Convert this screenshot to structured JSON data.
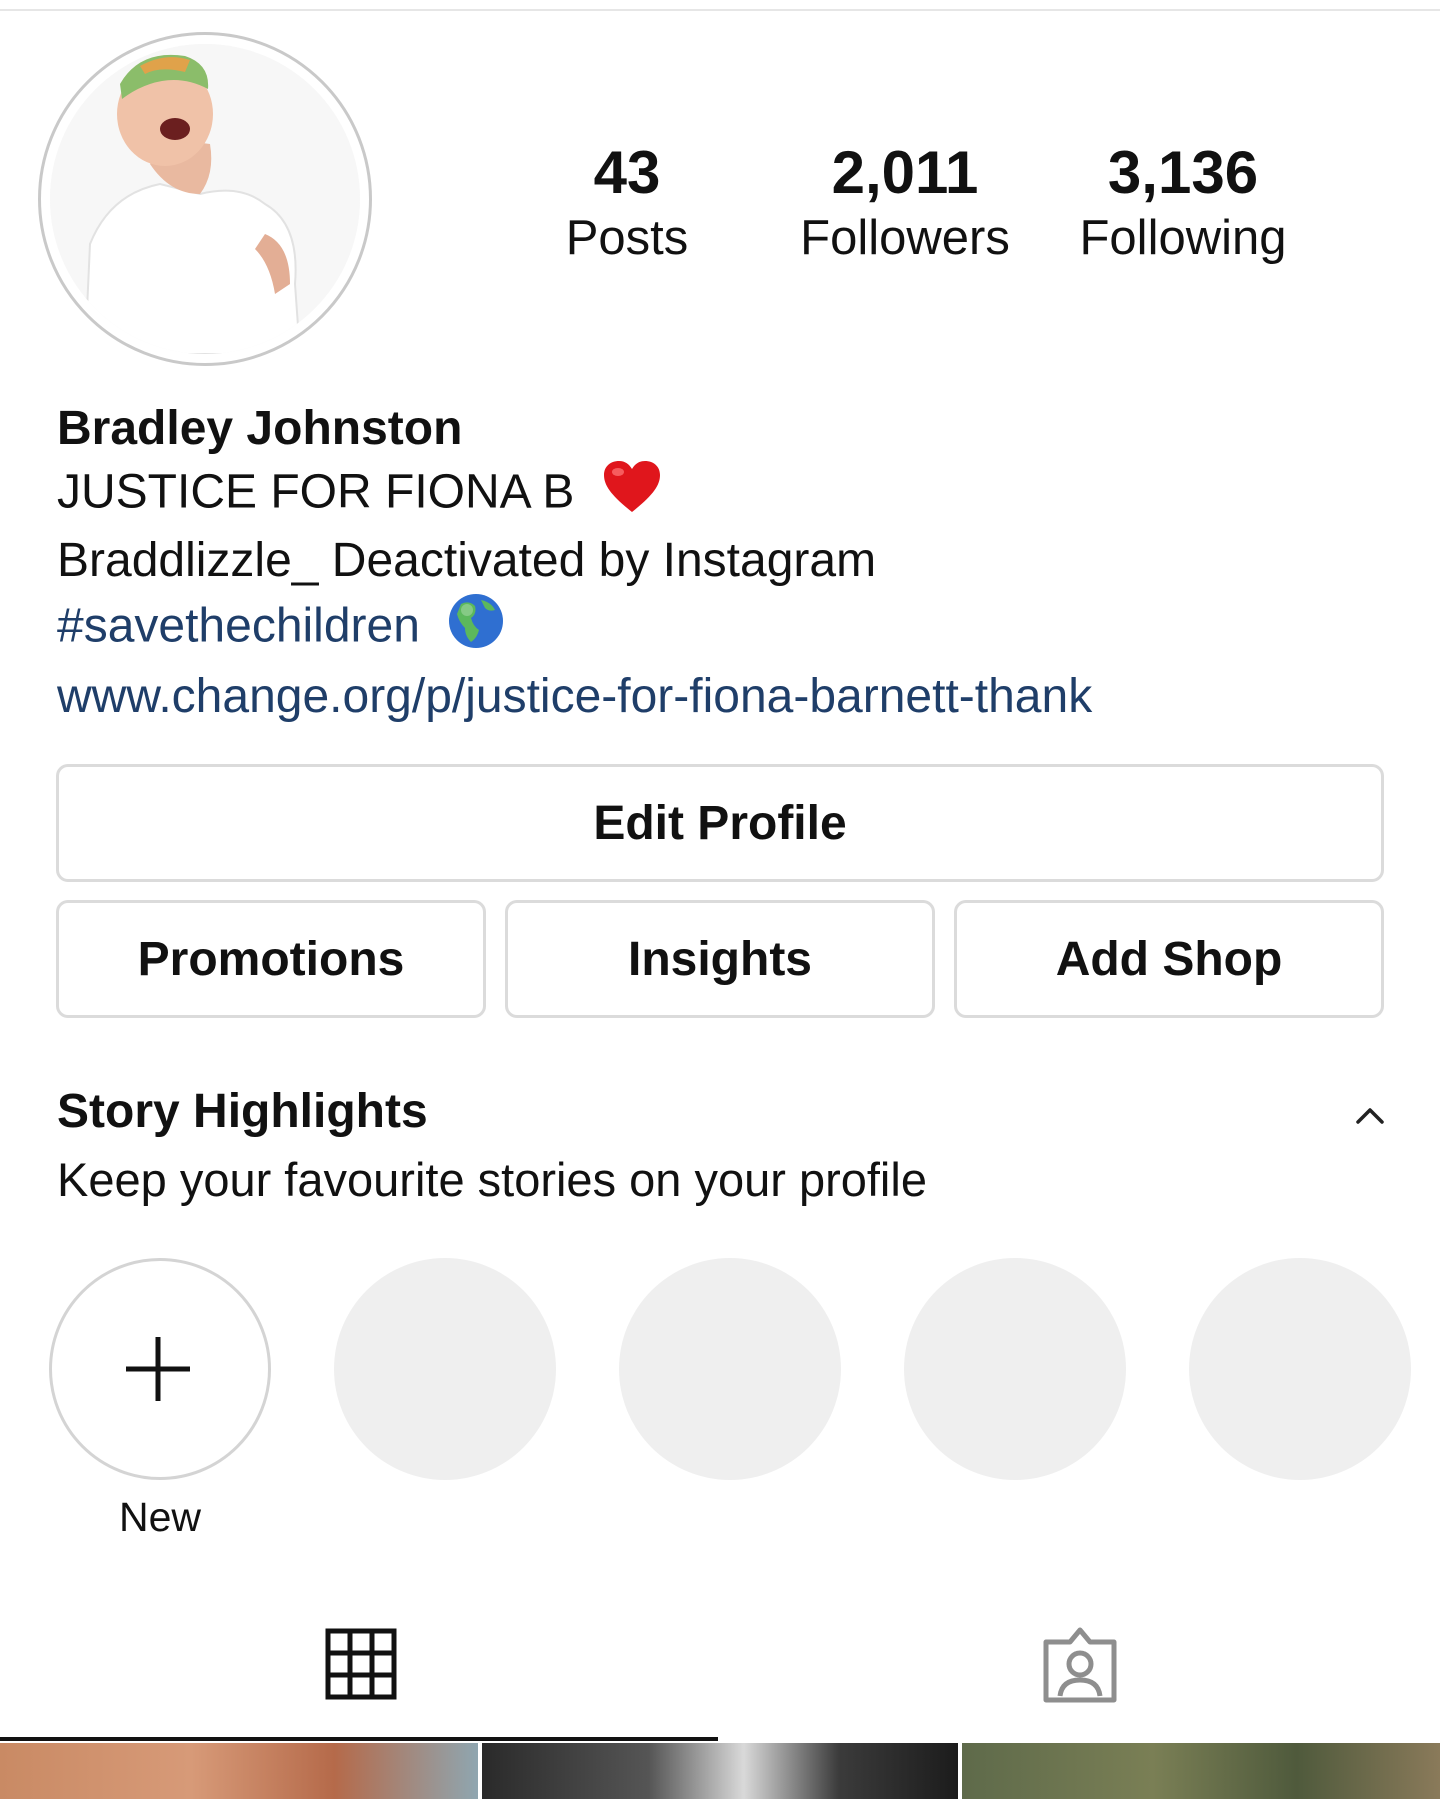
{
  "profile": {
    "stats": [
      {
        "value": "43",
        "label": "Posts"
      },
      {
        "value": "2,011",
        "label": "Followers"
      },
      {
        "value": "3,136",
        "label": "Following"
      }
    ],
    "name": "Bradley Johnston",
    "bio_line1": "JUSTICE FOR FIONA B",
    "bio_line2": "Braddlizzle_ Deactivated by Instagram",
    "hashtag": "#savethechildren",
    "website": "www.change.org/p/justice-for-fiona-barnett-thank"
  },
  "actions": {
    "edit_profile": "Edit Profile",
    "promotions": "Promotions",
    "insights": "Insights",
    "add_shop": "Add Shop"
  },
  "highlights": {
    "title": "Story Highlights",
    "subtitle": "Keep your favourite stories on your profile",
    "new_label": "New"
  },
  "icons": {
    "bio_emoji_1": "red-heart-icon",
    "bio_emoji_2": "globe-icon",
    "collapse": "chevron-up-icon",
    "tab_posts": "grid-icon",
    "tab_tagged": "tagged-person-icon"
  },
  "colors": {
    "link": "#1f3e69",
    "border": "#dbdbdb",
    "placeholder": "#efefef"
  }
}
